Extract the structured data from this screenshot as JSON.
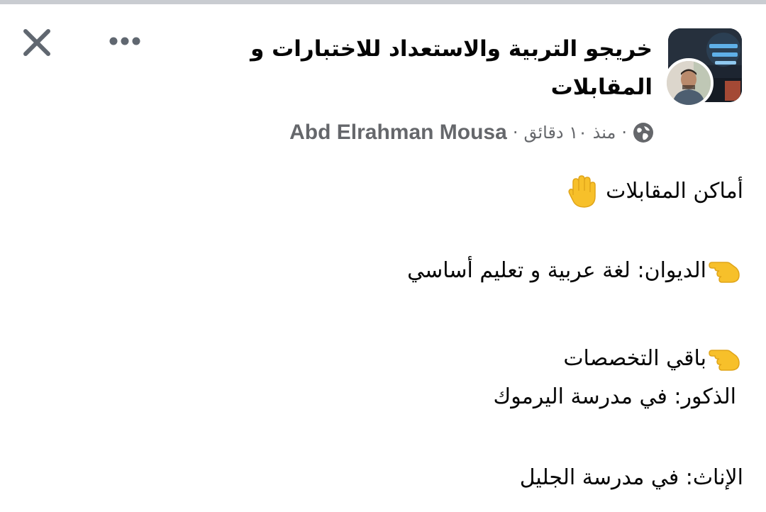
{
  "header": {
    "group_name": "خريجو التربية والاستعداد للاختبارات و المقابلات",
    "time_ago": "منذ ١٠ دقائق",
    "separator": "·",
    "author": "Abd Elrahman Mousa",
    "icons": {
      "close": "close-icon",
      "more": "more-options-icon",
      "privacy": "globe-icon"
    }
  },
  "post": {
    "line1": "أماكن المقابلات",
    "line2": "الديوان: لغة عربية و تعليم أساسي",
    "line3": "باقي التخصصات",
    "line4": "الذكور: في مدرسة اليرموك",
    "line5": "الإناث: في مدرسة الجليل",
    "emojis": {
      "hand": "raised-hand-icon",
      "pointer": "pointing-finger-icon"
    }
  },
  "colors": {
    "text_primary": "#050505",
    "text_secondary": "#65676b",
    "top_bar": "#c9ccd1",
    "emoji_yellow": "#f7c02a"
  }
}
